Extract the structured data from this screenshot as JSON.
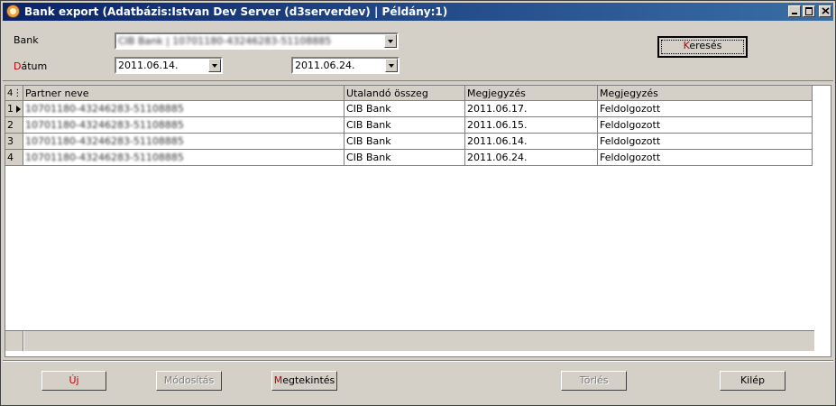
{
  "window": {
    "title": "Bank export   (Adatbázis:Istvan Dev Server (d3serverdev) | Példány:1)"
  },
  "filter": {
    "bank_label": "Bank",
    "datum_label_accel": "D",
    "datum_label_rest": "átum",
    "bank_value": "CIB Bank | 10701180-43246283-51108885",
    "date_from": "2011.06.14.",
    "date_to": "2011.06.24.",
    "search_button_accel": "K",
    "search_button_rest": "eresés"
  },
  "grid": {
    "corner": "4",
    "columns": [
      "Partner neve",
      "Utalandó összeg",
      "Megjegyzés",
      "Megjegyzés"
    ],
    "rows": [
      {
        "num": "1",
        "partner": "10701180-43246283-51108885",
        "amount": "CIB Bank",
        "note1": "2011.06.17.",
        "note2": "Feldolgozott"
      },
      {
        "num": "2",
        "partner": "10701180-43246283-51108885",
        "amount": "CIB Bank",
        "note1": "2011.06.15.",
        "note2": "Feldolgozott"
      },
      {
        "num": "3",
        "partner": "10701180-43246283-51108885",
        "amount": "CIB Bank",
        "note1": "2011.06.14.",
        "note2": "Feldolgozott"
      },
      {
        "num": "4",
        "partner": "10701180-43246283-51108885",
        "amount": "CIB Bank",
        "note1": "2011.06.24.",
        "note2": "Feldolgozott"
      }
    ]
  },
  "buttons": {
    "new": "Új",
    "modify": "Módosítás",
    "view_accel": "M",
    "view_rest": "egtekintés",
    "delete": "Törlés",
    "exit": "Kilép"
  }
}
